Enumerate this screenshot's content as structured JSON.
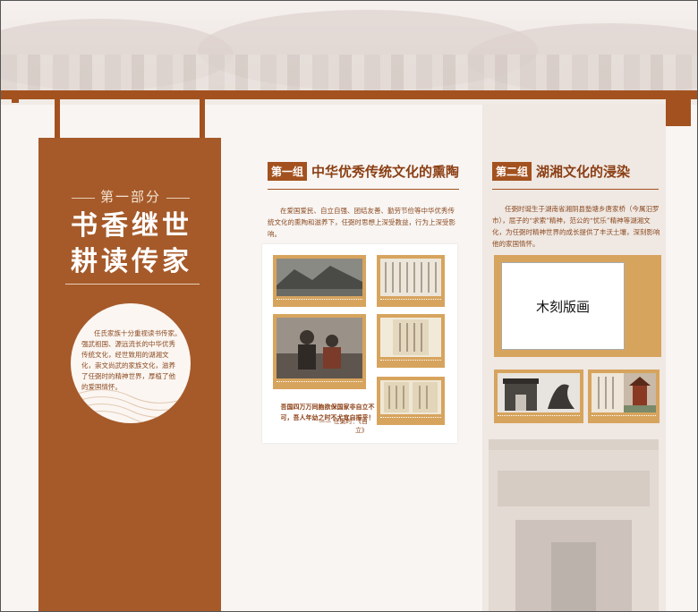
{
  "part": {
    "label": "第一部分",
    "title_line1": "书香继世",
    "title_line2": "耕读传家"
  },
  "intro": "任氏家族十分重视读书传家。强武祖国、源远流长的中华优秀传统文化，经世致用的湖湘文化，崇文尚武的家族文化，滋养了任弼时的精神世界，厚植了他的爱国情怀。",
  "group1": {
    "tag": "第一组",
    "title": "中华优秀传统文化的熏陶",
    "text": "在爱国爱民、自立自强、团结友善、勤劳节俭等中华优秀传统文化的熏陶和滋养下，任弼时思想上深受教益，行为上深受影响。",
    "quote": "吾国四万万同胞欲保国家非自立不可，吾人年幼之时不尤宜自振乎！",
    "quote_source": "—— 任弼时：《自立》"
  },
  "group2": {
    "tag": "第二组",
    "title": "湖湘文化的浸染",
    "text": "任弼时诞生于湖南省湘阴县塾塘乡唐家桥（今属汨罗市），屈子的“求索”精神，范公的“忧乐”精神等湖湘文化，为任弼时精神世界的成长提供了丰沃土壤，深刻影响他的家国情怀。",
    "placeholder": "木刻版画"
  },
  "colors": {
    "accent": "#a3521f",
    "banner": "#a65a2a",
    "frame_gold": "#d7a45e"
  }
}
